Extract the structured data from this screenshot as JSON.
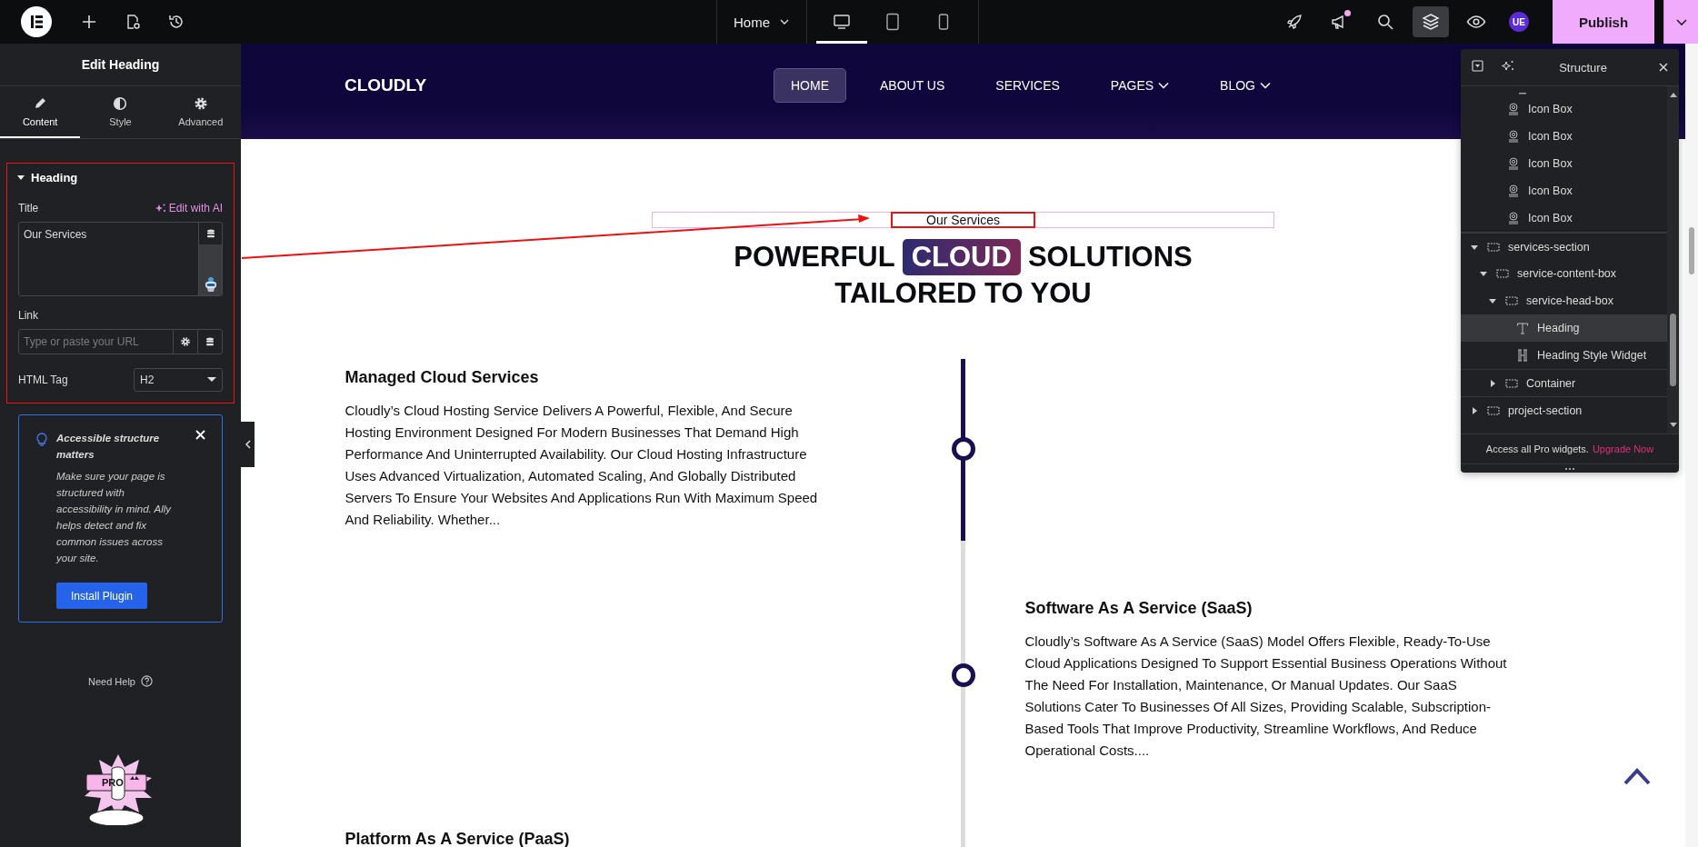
{
  "topbar": {
    "page_menu": "Home",
    "devices": [
      {
        "kind": "desktop",
        "selected": true
      },
      {
        "kind": "tablet",
        "selected": false
      },
      {
        "kind": "mobile",
        "selected": false
      }
    ],
    "tools": [
      {
        "kind": "rocket",
        "selected": false,
        "unread": false
      },
      {
        "kind": "megaphone",
        "selected": false,
        "unread": true
      },
      {
        "kind": "search",
        "selected": false,
        "unread": false
      },
      {
        "kind": "layers",
        "selected": true,
        "unread": false
      },
      {
        "kind": "eye",
        "selected": false,
        "unread": false
      }
    ],
    "avatar": "UE",
    "publish": "Publish"
  },
  "panel": {
    "title": "Edit Heading",
    "tabs": [
      {
        "label": "Content",
        "kind": "pencil",
        "selected": true
      },
      {
        "label": "Style",
        "kind": "contrast",
        "selected": false
      },
      {
        "label": "Advanced",
        "kind": "gear",
        "selected": false
      }
    ],
    "section": {
      "title": "Heading",
      "expanded": true,
      "title_label": "Title",
      "ai_action": "Edit with AI",
      "title_value": "Our Services",
      "link_label": "Link",
      "link_placeholder": "Type or paste your URL",
      "tag_label": "HTML Tag",
      "tag_value": "H2"
    },
    "notice": {
      "title": "Accessible structure matters",
      "body": "Make sure your page is structured with accessibility in mind. Ally helps detect and fix common issues across your site.",
      "button": "Install Plugin"
    },
    "help": "Need Help",
    "pro_badge": "PRO"
  },
  "site": {
    "logo": "CLOUDLY",
    "nav": [
      {
        "label": "HOME",
        "selected": true,
        "dropdown": false
      },
      {
        "label": "ABOUT US",
        "selected": false,
        "dropdown": false
      },
      {
        "label": "SERVICES",
        "selected": false,
        "dropdown": false
      },
      {
        "label": "PAGES",
        "selected": false,
        "dropdown": true
      },
      {
        "label": "BLOG",
        "selected": false,
        "dropdown": true
      }
    ],
    "eyebrow": "Our Services",
    "heading_before": "POWERFUL",
    "heading_highlight": "CLOUD",
    "heading_after": "SOLUTIONS",
    "heading_line2": "TAILORED TO YOU",
    "services": [
      {
        "reached": true,
        "title": "Managed Cloud Services",
        "text": "Cloudly’s Cloud Hosting Service Delivers A Powerful, Flexible, And Secure Hosting Environment Designed For Modern Businesses That Demand High Performance And Uninterrupted Availability. Our Cloud Hosting Infrastructure Uses Advanced Virtualization, Automated Scaling, And Globally Distributed Servers To Ensure Your Websites And Applications Run With Maximum Speed And Reliability. Whether..."
      },
      {
        "reached": false,
        "title": "Software As A Service (SaaS)",
        "text": "Cloudly’s Software As A Service (SaaS) Model Offers Flexible, Ready-To-Use Cloud Applications Designed To Support Essential Business Operations Without The Need For Installation, Maintenance, Or Manual Updates. Our SaaS Solutions Cater To Businesses Of All Sizes, Providing Scalable, Subscription-Based Tools That Improve Productivity, Streamline Workflows, And Reduce Operational Costs...."
      },
      {
        "reached": false,
        "title": "Platform As A Service (PaaS)"
      }
    ]
  },
  "structure": {
    "title": "Structure",
    "items_above": [
      {
        "label": "Icon Box",
        "kind": "icon-box",
        "selected": false
      },
      {
        "label": "Icon Box",
        "kind": "icon-box",
        "selected": false
      },
      {
        "label": "Icon Box",
        "kind": "icon-box",
        "selected": false
      },
      {
        "label": "Icon Box",
        "kind": "icon-box",
        "selected": false
      },
      {
        "label": "Icon Box",
        "kind": "icon-box",
        "selected": false
      }
    ],
    "tree": [
      {
        "label": "services-section",
        "kind": "container",
        "expanded": true,
        "selected": false,
        "children": [
          {
            "label": "service-content-box",
            "kind": "container",
            "expanded": true,
            "selected": false,
            "children": [
              {
                "label": "service-head-box",
                "kind": "container",
                "expanded": true,
                "selected": false,
                "children": [
                  {
                    "label": "Heading",
                    "kind": "heading",
                    "selected": true
                  },
                  {
                    "label": "Heading Style Widget",
                    "kind": "heading-style",
                    "selected": false
                  }
                ]
              },
              {
                "label": "Container",
                "kind": "container",
                "expanded": false,
                "selected": false
              }
            ]
          }
        ]
      },
      {
        "label": "project-section",
        "kind": "container",
        "expanded": false,
        "selected": false
      }
    ],
    "promo_text": "Access all Pro widgets.",
    "promo_link": "Upgrade Now"
  }
}
